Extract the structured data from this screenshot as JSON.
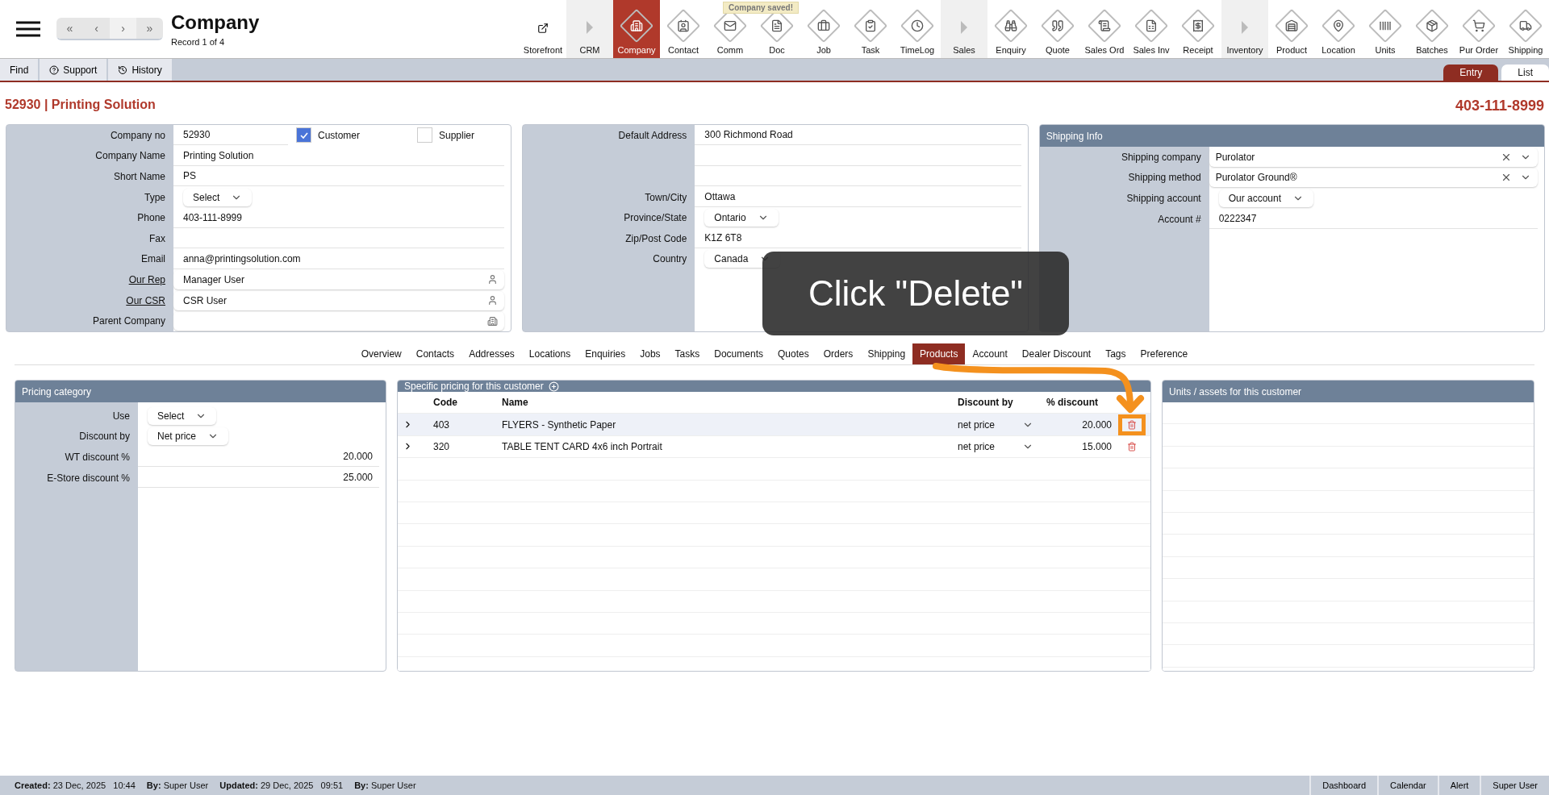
{
  "header": {
    "title": "Company",
    "subtitle": "Record 1 of 4",
    "nav": [
      "«",
      "‹",
      "›",
      "»"
    ]
  },
  "toast": "Company saved!",
  "toolbar": [
    {
      "label": "Storefront",
      "kind": "link",
      "selected": false
    },
    {
      "label": "CRM",
      "kind": "group",
      "selected": false
    },
    {
      "label": "Company",
      "kind": "module",
      "selected": true
    },
    {
      "label": "Contact",
      "kind": "module",
      "selected": false
    },
    {
      "label": "Comm",
      "kind": "module",
      "selected": false
    },
    {
      "label": "Doc",
      "kind": "module",
      "selected": false
    },
    {
      "label": "Job",
      "kind": "module",
      "selected": false
    },
    {
      "label": "Task",
      "kind": "module",
      "selected": false
    },
    {
      "label": "TimeLog",
      "kind": "module",
      "selected": false
    },
    {
      "label": "Sales",
      "kind": "group",
      "selected": false
    },
    {
      "label": "Enquiry",
      "kind": "module",
      "selected": false
    },
    {
      "label": "Quote",
      "kind": "module",
      "selected": false
    },
    {
      "label": "Sales Ord",
      "kind": "module",
      "selected": false
    },
    {
      "label": "Sales Inv",
      "kind": "module",
      "selected": false
    },
    {
      "label": "Receipt",
      "kind": "module",
      "selected": false
    },
    {
      "label": "Inventory",
      "kind": "group",
      "selected": false
    },
    {
      "label": "Product",
      "kind": "module",
      "selected": false
    },
    {
      "label": "Location",
      "kind": "module",
      "selected": false
    },
    {
      "label": "Units",
      "kind": "module",
      "selected": false
    },
    {
      "label": "Batches",
      "kind": "module",
      "selected": false
    },
    {
      "label": "Pur Order",
      "kind": "module",
      "selected": false
    },
    {
      "label": "Shipping",
      "kind": "module",
      "selected": false
    }
  ],
  "subbar": [
    {
      "label": "Find",
      "kind": "plain"
    },
    {
      "label": "Support",
      "kind": "help"
    },
    {
      "label": "History",
      "kind": "history"
    }
  ],
  "view_tabs": [
    {
      "label": "Entry",
      "selected": true
    },
    {
      "label": "List",
      "selected": false
    }
  ],
  "record": {
    "title": "52930 | Printing Solution",
    "phone": "403-111-8999"
  },
  "company": {
    "rows": [
      {
        "label": "Company no",
        "value": "52930",
        "kind": "text",
        "checks": [
          {
            "label": "Customer",
            "checked": true
          },
          {
            "label": "Supplier",
            "checked": false
          }
        ]
      },
      {
        "label": "Company Name",
        "value": "Printing Solution",
        "kind": "text"
      },
      {
        "label": "Short Name",
        "value": "PS",
        "kind": "text"
      },
      {
        "label": "Type",
        "value": "Select",
        "kind": "select"
      },
      {
        "label": "Phone",
        "value": "403-111-8999",
        "kind": "text"
      },
      {
        "label": "Fax",
        "kind": "text"
      },
      {
        "label": "Email",
        "value": "anna@printingsolution.com",
        "kind": "text"
      },
      {
        "label": "Our Rep",
        "value": "Manager User",
        "kind": "person",
        "link": true
      },
      {
        "label": "Our CSR",
        "value": "CSR User",
        "kind": "person",
        "link": true
      },
      {
        "label": "Parent Company",
        "kind": "building"
      }
    ]
  },
  "address": {
    "rows": [
      {
        "label": "Default Address",
        "value": "300 Richmond Road",
        "kind": "text"
      },
      {
        "kind": "text"
      },
      {
        "kind": "text"
      },
      {
        "label": "Town/City",
        "value": "Ottawa",
        "kind": "text"
      },
      {
        "label": "Province/State",
        "value": "Ontario",
        "kind": "select"
      },
      {
        "label": "Zip/Post Code",
        "value": "K1Z 6T8",
        "kind": "text"
      },
      {
        "label": "Country",
        "value": "Canada",
        "kind": "select"
      }
    ]
  },
  "shipping": {
    "title": "Shipping Info",
    "rows": [
      {
        "label": "Shipping company",
        "value": "Purolator",
        "kind": "clearable"
      },
      {
        "label": "Shipping method",
        "value": "Purolator Ground®",
        "kind": "clearable"
      },
      {
        "label": "Shipping account",
        "value": "Our account",
        "kind": "select"
      },
      {
        "label": "Account #",
        "value": "0222347",
        "kind": "text"
      }
    ]
  },
  "section_tabs": [
    {
      "label": "Overview",
      "selected": false
    },
    {
      "label": "Contacts",
      "selected": false
    },
    {
      "label": "Addresses",
      "selected": false
    },
    {
      "label": "Locations",
      "selected": false
    },
    {
      "label": "Enquiries",
      "selected": false
    },
    {
      "label": "Jobs",
      "selected": false
    },
    {
      "label": "Tasks",
      "selected": false
    },
    {
      "label": "Documents",
      "selected": false
    },
    {
      "label": "Quotes",
      "selected": false
    },
    {
      "label": "Orders",
      "selected": false
    },
    {
      "label": "Shipping",
      "selected": false
    },
    {
      "label": "Products",
      "selected": true
    },
    {
      "label": "Account",
      "selected": false
    },
    {
      "label": "Dealer Discount",
      "selected": false
    },
    {
      "label": "Tags",
      "selected": false
    },
    {
      "label": "Preference",
      "selected": false
    }
  ],
  "pricing": {
    "title": "Pricing category",
    "rows": [
      {
        "label": "Use",
        "value": "Select",
        "kind": "select"
      },
      {
        "label": "Discount by",
        "value": "Net price",
        "kind": "select"
      },
      {
        "label": "WT discount %",
        "value": "20.000",
        "kind": "number"
      },
      {
        "label": "E-Store discount %",
        "value": "25.000",
        "kind": "number"
      }
    ]
  },
  "specific": {
    "title": "Specific pricing for this customer",
    "columns": [
      "Code",
      "Name",
      "Discount by",
      "% discount"
    ],
    "rows": [
      {
        "code": "403",
        "name": "FLYERS - Synthetic Paper",
        "discount_by": "net price",
        "discount": "20.000",
        "selected": true
      },
      {
        "code": "320",
        "name": "TABLE TENT CARD 4x6 inch Portrait",
        "discount_by": "net price",
        "discount": "15.000",
        "selected": false
      }
    ]
  },
  "units": {
    "title": "Units / assets for this customer"
  },
  "tutorial": {
    "callout": "Click \"Delete\""
  },
  "footer": {
    "left": [
      {
        "label": "Created:",
        "value": "23 Dec, 2025   10:44"
      },
      {
        "label": "By:",
        "value": "Super User"
      },
      {
        "label": "Updated:",
        "value": "29 Dec, 2025   09:51"
      },
      {
        "label": "By:",
        "value": "Super User"
      }
    ],
    "right": [
      "Dashboard",
      "Calendar",
      "Alert",
      "Super User"
    ]
  }
}
